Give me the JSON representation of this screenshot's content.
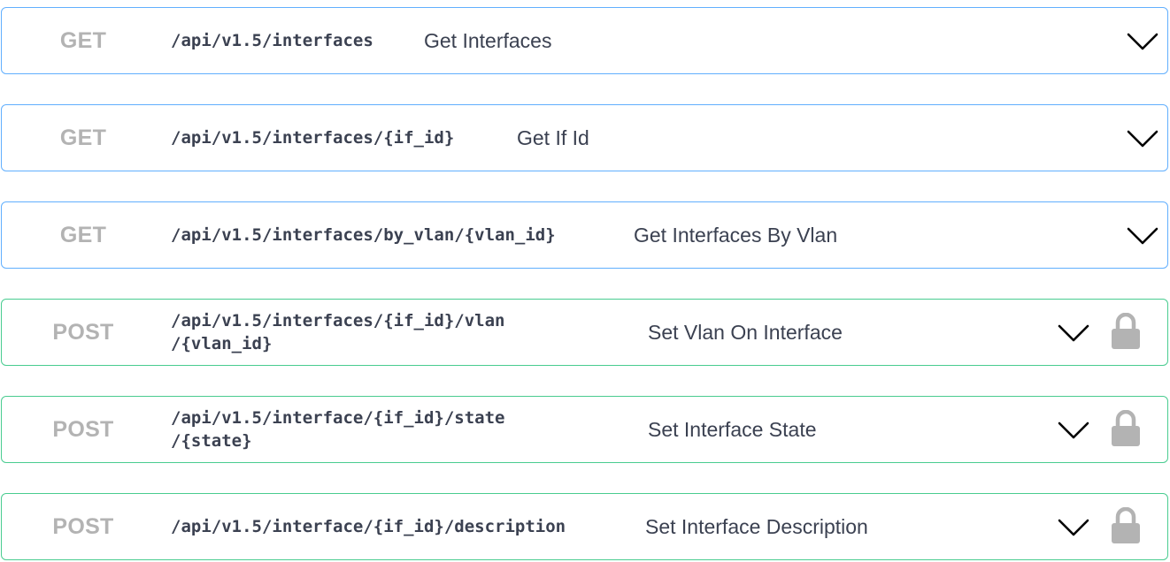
{
  "operations": [
    {
      "method": "GET",
      "path_line1": "/api/v1.5/interfaces",
      "path_line2": "",
      "summary": "Get Interfaces",
      "locked": false
    },
    {
      "method": "GET",
      "path_line1": "/api/v1.5/interfaces/{if_id}",
      "path_line2": "",
      "summary": "Get If Id",
      "locked": false
    },
    {
      "method": "GET",
      "path_line1": "/api/v1.5/interfaces/by_vlan/{vlan_id}",
      "path_line2": "",
      "summary": "Get Interfaces By Vlan",
      "locked": false
    },
    {
      "method": "POST",
      "path_line1": "/api/v1.5/interfaces/{if_id}/vlan",
      "path_line2": "/{vlan_id}",
      "summary": "Set Vlan On Interface",
      "locked": true
    },
    {
      "method": "POST",
      "path_line1": "/api/v1.5/interface/{if_id}/state",
      "path_line2": "/{state}",
      "summary": "Set Interface State",
      "locked": true
    },
    {
      "method": "POST",
      "path_line1": "/api/v1.5/interface/{if_id}/description",
      "path_line2": "",
      "summary": "Set Interface Description",
      "locked": true
    }
  ],
  "icons": {
    "expand": "chevron-down-icon",
    "lock": "lock-icon"
  },
  "colors": {
    "get_border": "#61affe",
    "post_border": "#49cc90",
    "method_text": "#b3b3b3",
    "text": "#3b4151",
    "lock": "#b3b3b3"
  }
}
